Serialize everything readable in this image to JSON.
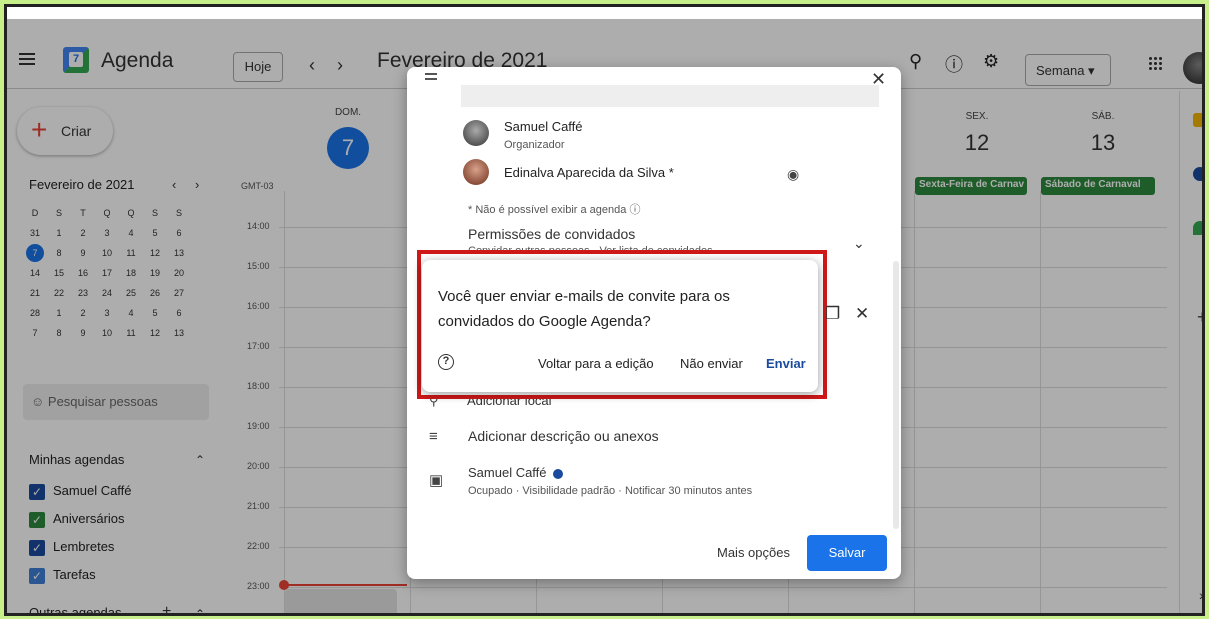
{
  "header": {
    "app_title": "Agenda",
    "today_label": "Hoje",
    "prev_symbol": "‹",
    "next_symbol": "›",
    "month_title": "Fevereiro de 2021",
    "view_select": "Semana ▾",
    "icons": [
      "menu-icon",
      "search-icon",
      "help-icon",
      "settings-icon",
      "apps-icon",
      "account-avatar"
    ]
  },
  "sidebar": {
    "create_label": "Criar",
    "mini_calendar": {
      "title": "Fevereiro de 2021",
      "weekday_headers": [
        "D",
        "S",
        "T",
        "Q",
        "Q",
        "S",
        "S"
      ],
      "weeks": [
        [
          "31",
          "1",
          "2",
          "3",
          "4",
          "5",
          "6"
        ],
        [
          "7",
          "8",
          "9",
          "10",
          "11",
          "12",
          "13"
        ],
        [
          "14",
          "15",
          "16",
          "17",
          "18",
          "19",
          "20"
        ],
        [
          "21",
          "22",
          "23",
          "24",
          "25",
          "26",
          "27"
        ],
        [
          "28",
          "1",
          "2",
          "3",
          "4",
          "5",
          "6"
        ],
        [
          "7",
          "8",
          "9",
          "10",
          "11",
          "12",
          "13"
        ]
      ],
      "selected_day": "7"
    },
    "search_people_placeholder": "Pesquisar pessoas",
    "my_calendars_title": "Minhas agendas",
    "my_calendars": [
      {
        "label": "Samuel Caffé",
        "color": "#1a4a9e"
      },
      {
        "label": "Aniversários",
        "color": "#2d8a3e"
      },
      {
        "label": "Lembretes",
        "color": "#1a4a9e"
      },
      {
        "label": "Tarefas",
        "color": "#3f7fd6"
      }
    ],
    "other_calendars_title": "Outras agendas"
  },
  "week": {
    "timezone": "GMT-03",
    "days": [
      {
        "name": "DOM.",
        "number": "7"
      },
      {
        "name": "SEX.",
        "number": "12"
      },
      {
        "name": "SÁB.",
        "number": "13"
      }
    ],
    "all_day_events": [
      "Sexta-Feira de Carnav",
      "Sábado de Carnaval"
    ],
    "hours": [
      "14:00",
      "15:00",
      "16:00",
      "17:00",
      "18:00",
      "19:00",
      "20:00",
      "21:00",
      "22:00",
      "23:00"
    ]
  },
  "event_dialog": {
    "guests": [
      {
        "name": "Samuel Caffé",
        "role": "Organizador"
      },
      {
        "name": "Edinalva Aparecida da Silva *",
        "role": ""
      }
    ],
    "agenda_note": "* Não é possível exibir a agenda",
    "permissions_title": "Permissões de convidados",
    "permissions_sub": "Convidar outras pessoas · Ver lista de convidados",
    "location_label": "Adicionar local",
    "description_label": "Adicionar descrição ou anexos",
    "calendar_name": "Samuel Caffé",
    "calendar_details": "Ocupado · Visibilidade padrão · Notificar 30 minutos antes",
    "more_options": "Mais opções",
    "save_label": "Salvar"
  },
  "confirm_dialog": {
    "message": "Você quer enviar e-mails de convite para os convidados do Google Agenda?",
    "back_label": "Voltar para a edição",
    "dont_send_label": "Não enviar",
    "send_label": "Enviar",
    "highlight_color": "#d01818"
  }
}
